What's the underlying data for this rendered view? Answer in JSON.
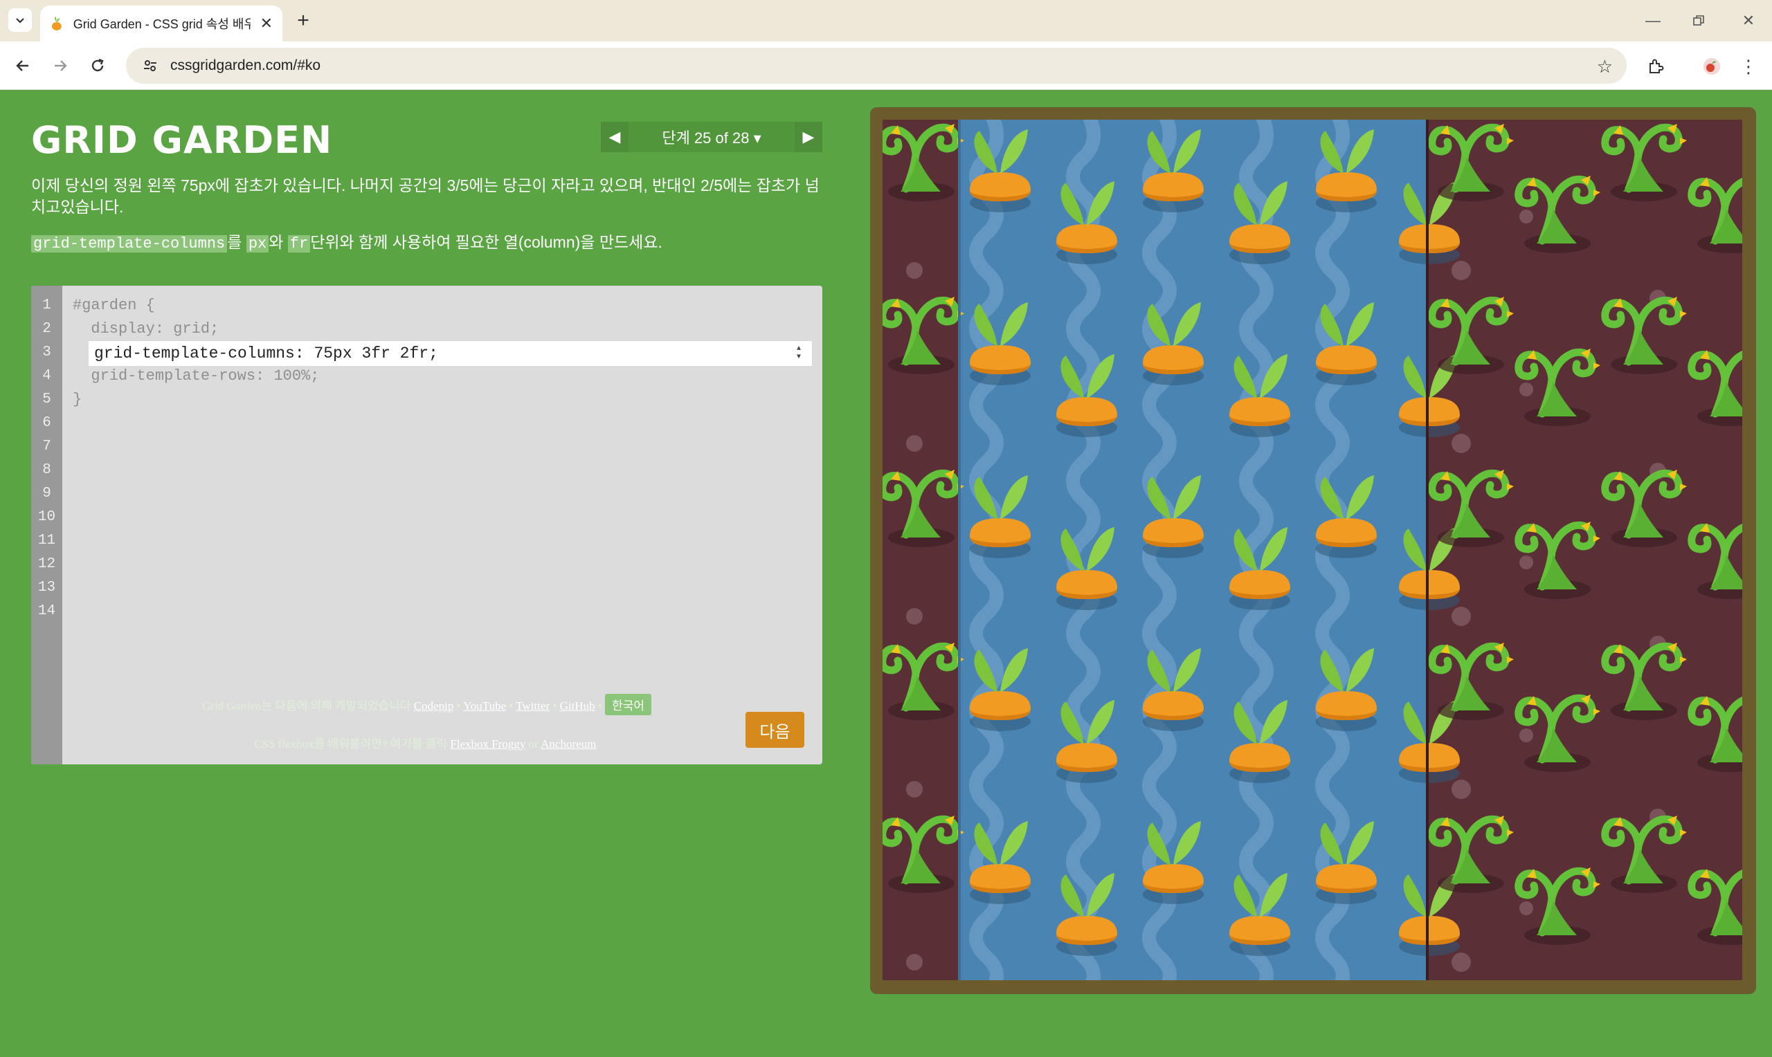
{
  "browser": {
    "tab_title": "Grid Garden - CSS grid 속성 배우기",
    "url": "cssgridgarden.com/#ko"
  },
  "page": {
    "title": "GRID GARDEN",
    "level": {
      "label": "단계 25 of 28 ▾",
      "prev": "◀",
      "next": "▶"
    },
    "instruction_1": "이제 당신의 정원 왼쪽 75px에 잡초가 있습니다. 나머지 공간의 3/5에는 당근이 자라고 있으며, 반대인 2/5에는 잡초가 넘치고있습니다.",
    "instruction_2": {
      "code_1": "grid-template-columns",
      "text_1": "를 ",
      "code_2": "px",
      "text_2": "와 ",
      "code_3": "fr",
      "text_3": "단위와 함께 사용하여 필요한 열(column)을 만드세요."
    },
    "editor": {
      "line_numbers": [
        "1",
        "2",
        "3",
        "4",
        "5",
        "6",
        "7",
        "8",
        "9",
        "10",
        "11",
        "12",
        "13",
        "14"
      ],
      "lines": [
        "#garden {",
        "  display: grid;",
        "",
        "  grid-template-rows: 100%;",
        "}"
      ],
      "input_value": "grid-template-columns: 75px 3fr 2fr;",
      "next_label": "다음"
    },
    "credits": {
      "prefix": "Grid Garden는 다음에 의해 개발되었습니다 ",
      "links": [
        "Codepip",
        "YouTube",
        "Twitter",
        "GitHub"
      ],
      "separator": " • ",
      "language": "한국어"
    },
    "credits2": {
      "prefix": "CSS flexbox를 배워볼려면? 여기를 클릭 ",
      "link_1": "Flexbox Froggy",
      "middle": " or ",
      "link_2": "Anchoreum",
      "suffix": "."
    }
  },
  "garden": {
    "colors": {
      "soil": "#5b2f36",
      "water": "#4a84b2",
      "frame": "#6c5b2d",
      "carrot": "#f29b22",
      "leaf": "#7ec33c",
      "weed": "#63c23a"
    }
  }
}
